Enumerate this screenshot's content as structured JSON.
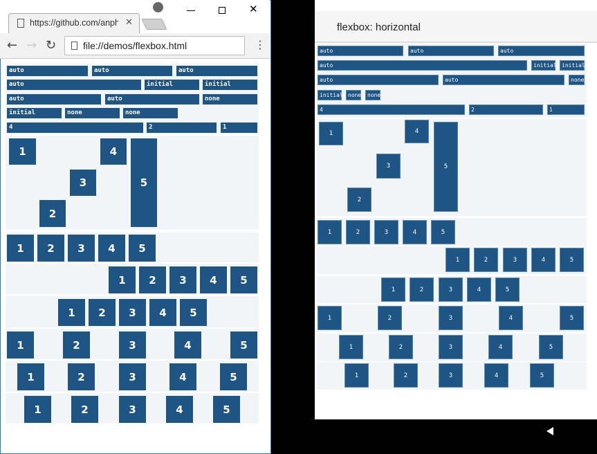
{
  "browser": {
    "tab_title": "https://github.com/anphira",
    "url": "file://demos/flexbox.html",
    "icons": [
      "page-icon",
      "close-icon",
      "back-icon",
      "forward-icon",
      "reload-icon",
      "menu-icon",
      "profile-icon",
      "minimize-icon",
      "maximize-icon",
      "window-close-icon"
    ]
  },
  "android": {
    "app_title": "flexbox: horizontal",
    "icons": [
      "notification-icon",
      "back-nav-icon"
    ]
  },
  "demo": {
    "label_rows": [
      [
        "auto",
        "auto",
        "auto"
      ],
      [
        "auto",
        "initial",
        "initial"
      ],
      [
        "auto",
        "auto",
        "none"
      ],
      [
        "initial",
        "none",
        "none"
      ],
      [
        "4",
        "2",
        "1"
      ]
    ],
    "item_labels": [
      "1",
      "2",
      "3",
      "4",
      "5"
    ]
  },
  "colors": {
    "box": "#1e5585",
    "section_bg": "#f2f5f7"
  }
}
